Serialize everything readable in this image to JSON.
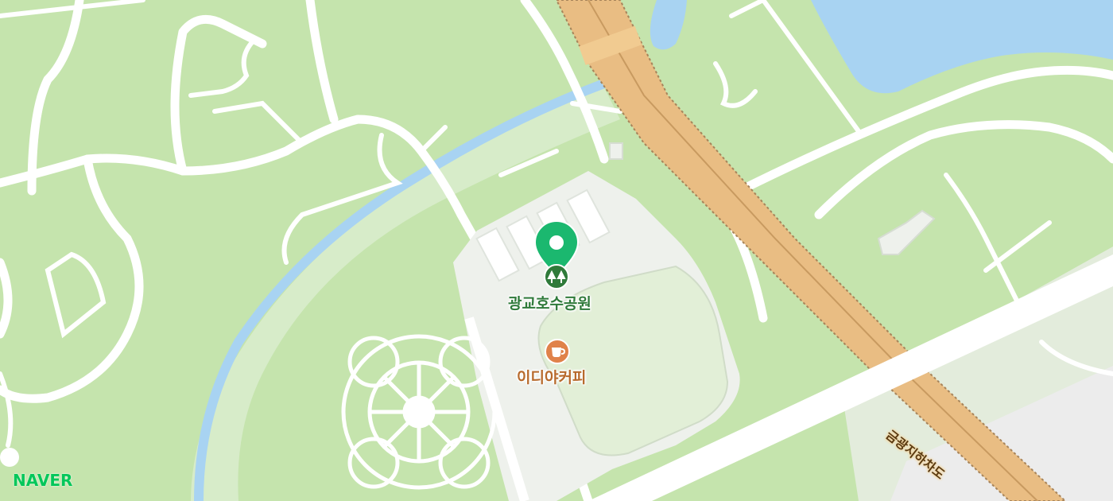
{
  "map": {
    "places": [
      {
        "name": "광교호수공원",
        "category_icon": "park-tree-icon",
        "selected": true,
        "color": "#1bb86f"
      },
      {
        "name": "이디야커피",
        "category_icon": "coffee-cup-icon",
        "color": "#e0824a"
      }
    ],
    "road_label": "금광지하차도",
    "logo": "NAVER",
    "colors": {
      "park": "#c5e4ad",
      "water": "#a8d3f2",
      "road": "#ffffff",
      "expressway": "#e9bd83",
      "plaza": "#eef1ec",
      "logo": "#03c75a"
    }
  }
}
